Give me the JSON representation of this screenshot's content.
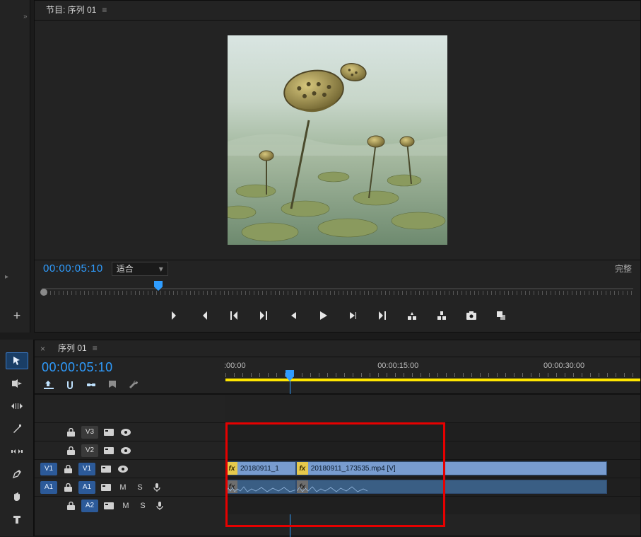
{
  "program": {
    "tab_title": "节目: 序列 01",
    "zoom_label": "适合",
    "timecode": "00:00:05:10",
    "right_status": "完整"
  },
  "transport": {
    "mark_in": "mark-in",
    "mark_out": "mark-out",
    "go_in": "go-to-in",
    "go_out": "go-to-out",
    "step_back": "step-back",
    "play": "play",
    "step_fwd": "step-forward",
    "go_end": "go-to-out-point",
    "lift": "lift",
    "extract": "extract",
    "export_frame": "export-frame",
    "button_editor": "button-editor"
  },
  "timeline": {
    "tab_title": "序列 01",
    "timecode": "00:00:05:10",
    "ruler": [
      {
        "label": ":00:00",
        "x_pct": 0
      },
      {
        "label": "00:00:15:00",
        "x_pct": 37
      },
      {
        "label": "00:00:30:00",
        "x_pct": 77
      }
    ],
    "playhead_x_pct": 15.5,
    "tracks": {
      "v3": "V3",
      "v2": "V2",
      "v1": "V1",
      "a1": "A1",
      "a2": "A2",
      "v1_sel": "V1",
      "a1_sel": "A1",
      "m": "M",
      "s": "S"
    },
    "clips": {
      "v_cut1": "20180911_1",
      "v_cut2": "20180911_173535.mp4 [V]",
      "cut_x_pct": 17,
      "end_x_pct": 92
    }
  },
  "icons": {
    "menu": "≡",
    "close": "×",
    "chev": "▾",
    "fx": "fx"
  }
}
